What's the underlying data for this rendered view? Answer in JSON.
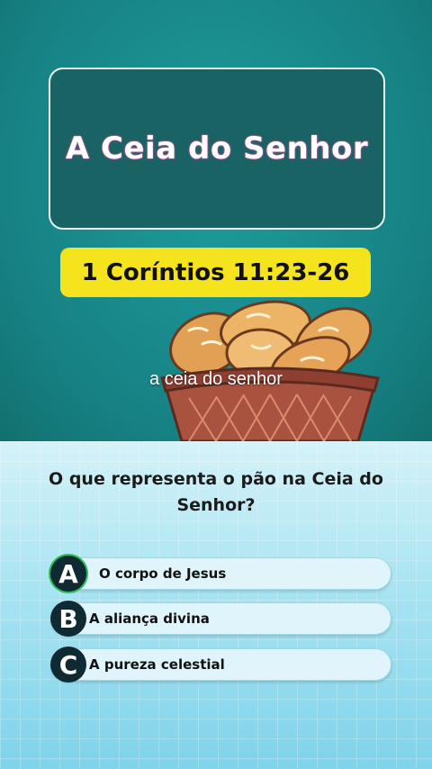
{
  "header": {
    "title": "A Ceia do Senhor",
    "reference": "1 Coríntios 11:23-26"
  },
  "overlay_caption": "a ceia do senhor",
  "illustration": {
    "icon": "bread-basket-icon"
  },
  "quiz": {
    "question": "O que representa o pão na Ceia do Senhor?",
    "options": [
      {
        "letter": "A",
        "text": "O corpo de Jesus"
      },
      {
        "letter": "B",
        "text": "A aliança divina"
      },
      {
        "letter": "C",
        "text": "A pureza celestial"
      }
    ]
  },
  "colors": {
    "teal": "#198a8c",
    "yellow": "#f5e31e",
    "dark_box": "#1a6364",
    "option_bg": "#dff5fb"
  }
}
